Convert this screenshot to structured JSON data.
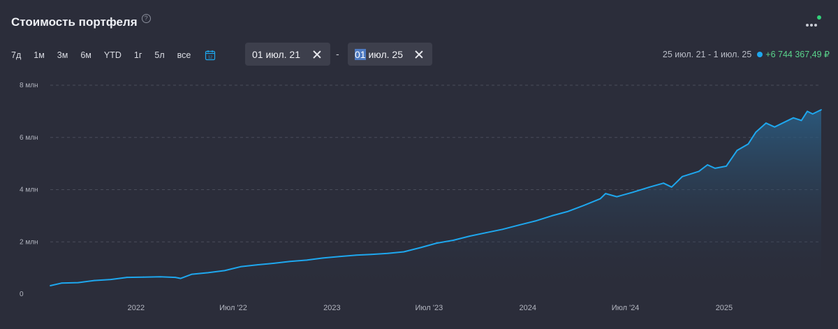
{
  "header": {
    "title": "Стоимость портфеля",
    "help_glyph": "?",
    "menu_icon": "more-dots-icon"
  },
  "periods": [
    "7д",
    "1м",
    "3м",
    "6м",
    "YTD",
    "1г",
    "5л",
    "все"
  ],
  "date_range": {
    "from_value": "01 июл. 21",
    "to_day": "01",
    "to_rest": " июл. 25"
  },
  "summary": {
    "range_label": "25 июл. 21 - 1 июл. 25",
    "change": "+6 744 367,49 ₽"
  },
  "colors": {
    "line": "#1ea7ee",
    "positive": "#5ad38b",
    "background": "#2b2d3a"
  },
  "chart_data": {
    "type": "area",
    "title": "Стоимость портфеля",
    "xlabel": "",
    "ylabel": "",
    "ylim": [
      0,
      8000000
    ],
    "xlim": [
      "2021-07-25",
      "2025-07-01"
    ],
    "y_ticks": [
      {
        "value": 0,
        "label": "0"
      },
      {
        "value": 2000000,
        "label": "2 млн"
      },
      {
        "value": 4000000,
        "label": "4 млн"
      },
      {
        "value": 6000000,
        "label": "6 млн"
      },
      {
        "value": 8000000,
        "label": "8 млн"
      }
    ],
    "x_ticks": [
      {
        "date": "2022-01-01",
        "label": "2022"
      },
      {
        "date": "2022-07-01",
        "label": "Июл '22"
      },
      {
        "date": "2023-01-01",
        "label": "2023"
      },
      {
        "date": "2023-07-01",
        "label": "Июл '23"
      },
      {
        "date": "2024-01-01",
        "label": "2024"
      },
      {
        "date": "2024-07-01",
        "label": "Июл '24"
      },
      {
        "date": "2025-01-01",
        "label": "2025"
      }
    ],
    "grid": "horizontal-dashed",
    "series": [
      {
        "points": [
          [
            "2021-07-25",
            320000
          ],
          [
            "2021-08-15",
            420000
          ],
          [
            "2021-09-15",
            440000
          ],
          [
            "2021-10-15",
            520000
          ],
          [
            "2021-11-15",
            560000
          ],
          [
            "2021-12-15",
            640000
          ],
          [
            "2022-01-15",
            650000
          ],
          [
            "2022-02-15",
            660000
          ],
          [
            "2022-03-15",
            640000
          ],
          [
            "2022-03-25",
            600000
          ],
          [
            "2022-04-15",
            760000
          ],
          [
            "2022-05-15",
            820000
          ],
          [
            "2022-06-15",
            900000
          ],
          [
            "2022-07-15",
            1050000
          ],
          [
            "2022-08-15",
            1120000
          ],
          [
            "2022-09-15",
            1180000
          ],
          [
            "2022-10-15",
            1250000
          ],
          [
            "2022-11-15",
            1300000
          ],
          [
            "2022-12-15",
            1380000
          ],
          [
            "2023-01-15",
            1440000
          ],
          [
            "2023-02-15",
            1490000
          ],
          [
            "2023-03-15",
            1520000
          ],
          [
            "2023-04-15",
            1560000
          ],
          [
            "2023-05-15",
            1620000
          ],
          [
            "2023-06-15",
            1780000
          ],
          [
            "2023-07-15",
            1950000
          ],
          [
            "2023-08-15",
            2060000
          ],
          [
            "2023-09-15",
            2220000
          ],
          [
            "2023-10-15",
            2350000
          ],
          [
            "2023-11-15",
            2480000
          ],
          [
            "2023-12-15",
            2640000
          ],
          [
            "2024-01-15",
            2800000
          ],
          [
            "2024-02-15",
            3000000
          ],
          [
            "2024-03-15",
            3160000
          ],
          [
            "2024-04-15",
            3400000
          ],
          [
            "2024-05-15",
            3650000
          ],
          [
            "2024-05-25",
            3850000
          ],
          [
            "2024-06-15",
            3730000
          ],
          [
            "2024-07-15",
            3900000
          ],
          [
            "2024-08-15",
            4100000
          ],
          [
            "2024-09-10",
            4250000
          ],
          [
            "2024-09-25",
            4100000
          ],
          [
            "2024-10-15",
            4500000
          ],
          [
            "2024-11-15",
            4700000
          ],
          [
            "2024-12-01",
            4950000
          ],
          [
            "2024-12-15",
            4820000
          ],
          [
            "2025-01-05",
            4900000
          ],
          [
            "2025-01-25",
            5500000
          ],
          [
            "2025-02-15",
            5750000
          ],
          [
            "2025-03-01",
            6200000
          ],
          [
            "2025-03-20",
            6550000
          ],
          [
            "2025-04-05",
            6400000
          ],
          [
            "2025-04-25",
            6600000
          ],
          [
            "2025-05-10",
            6750000
          ],
          [
            "2025-05-25",
            6650000
          ],
          [
            "2025-06-05",
            7000000
          ],
          [
            "2025-06-15",
            6900000
          ],
          [
            "2025-07-01",
            7060000
          ]
        ]
      }
    ]
  }
}
